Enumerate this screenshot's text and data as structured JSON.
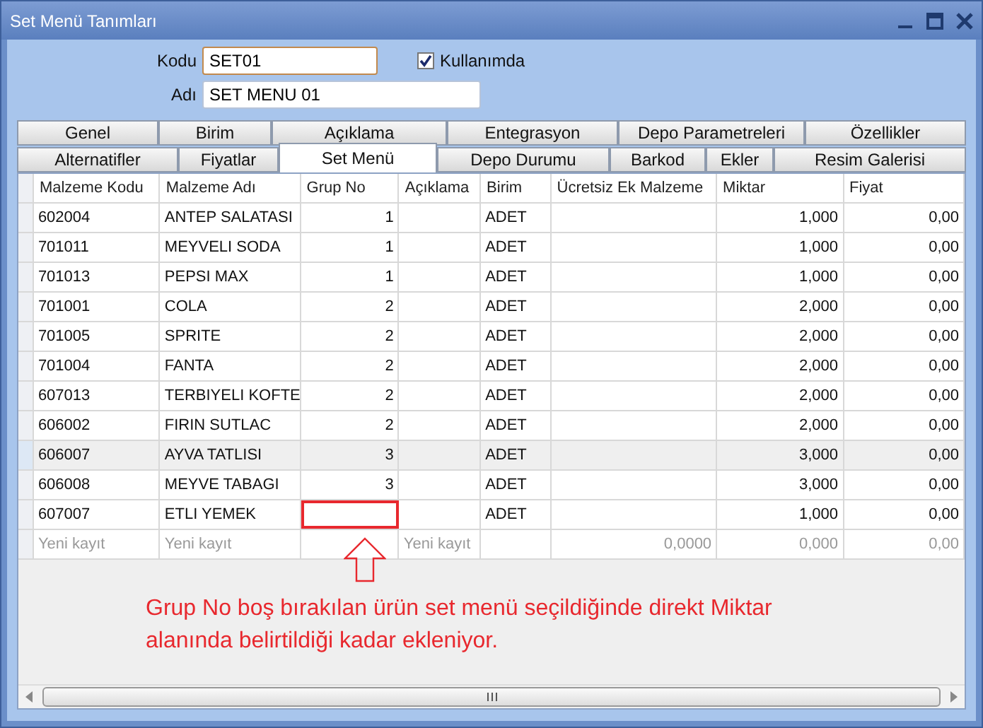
{
  "window": {
    "title": "Set Menü Tanımları"
  },
  "form": {
    "code_label": "Kodu",
    "code_value": "SET01",
    "name_label": "Adı",
    "name_value": "SET MENU 01",
    "in_use": {
      "label": "Kullanımda",
      "checked": true
    }
  },
  "tab_rows": [
    [
      {
        "label": "Genel",
        "selected": false
      },
      {
        "label": "Birim",
        "selected": false
      },
      {
        "label": "Açıklama",
        "selected": false
      },
      {
        "label": "Entegrasyon",
        "selected": false
      },
      {
        "label": "Depo Parametreleri",
        "selected": false
      },
      {
        "label": "Özellikler",
        "selected": false
      }
    ],
    [
      {
        "label": "Alternatifler",
        "selected": false
      },
      {
        "label": "Fiyatlar",
        "selected": false
      },
      {
        "label": "Set Menü",
        "selected": true
      },
      {
        "label": "Depo Durumu",
        "selected": false
      },
      {
        "label": "Barkod",
        "selected": false
      },
      {
        "label": "Ekler",
        "selected": false
      },
      {
        "label": "Resim Galerisi",
        "selected": false
      }
    ]
  ],
  "table": {
    "columns": [
      "Malzeme Kodu",
      "Malzeme Adı",
      "Grup No",
      "Açıklama",
      "Birim",
      "Ücretsiz Ek Malzeme",
      "Miktar",
      "Fiyat"
    ],
    "rows": [
      {
        "cells": [
          "602004",
          "ANTEP SALATASI",
          "1",
          "",
          "ADET",
          "",
          "1,000",
          "0,00"
        ],
        "selected": false,
        "marked": false
      },
      {
        "cells": [
          "701011",
          "MEYVELI SODA",
          "1",
          "",
          "ADET",
          "",
          "1,000",
          "0,00"
        ],
        "selected": false,
        "marked": false
      },
      {
        "cells": [
          "701013",
          "PEPSI MAX",
          "1",
          "",
          "ADET",
          "",
          "1,000",
          "0,00"
        ],
        "selected": false,
        "marked": false
      },
      {
        "cells": [
          "701001",
          "COLA",
          "2",
          "",
          "ADET",
          "",
          "2,000",
          "0,00"
        ],
        "selected": false,
        "marked": false
      },
      {
        "cells": [
          "701005",
          "SPRITE",
          "2",
          "",
          "ADET",
          "",
          "2,000",
          "0,00"
        ],
        "selected": false,
        "marked": false
      },
      {
        "cells": [
          "701004",
          "FANTA",
          "2",
          "",
          "ADET",
          "",
          "2,000",
          "0,00"
        ],
        "selected": false,
        "marked": false
      },
      {
        "cells": [
          "607013",
          "TERBIYELI KOFTE",
          "2",
          "",
          "ADET",
          "",
          "2,000",
          "0,00"
        ],
        "selected": false,
        "marked": false
      },
      {
        "cells": [
          "606002",
          "FIRIN SUTLAC",
          "2",
          "",
          "ADET",
          "",
          "2,000",
          "0,00"
        ],
        "selected": false,
        "marked": false
      },
      {
        "cells": [
          "606007",
          "AYVA TATLISI",
          "3",
          "",
          "ADET",
          "",
          "3,000",
          "0,00"
        ],
        "selected": true,
        "marked": false
      },
      {
        "cells": [
          "606008",
          "MEYVE TABAGI",
          "3",
          "",
          "ADET",
          "",
          "3,000",
          "0,00"
        ],
        "selected": false,
        "marked": false
      },
      {
        "cells": [
          "607007",
          "ETLI YEMEK",
          "",
          "",
          "ADET",
          "",
          "1,000",
          "0,00"
        ],
        "selected": false,
        "marked": true
      }
    ],
    "new_row": {
      "malzeme_kodu": "Yeni kayıt",
      "malzeme_adi": "Yeni kayıt",
      "aciklama": "Yeni kayıt",
      "ucretsiz_ek_malzeme": "0,0000",
      "miktar": "0,000",
      "fiyat": "0,00"
    }
  },
  "annotation": "Grup No boş bırakılan ürün set menü seçildiğinde direkt Miktar alanında belirtildiği kadar ekleniyor."
}
